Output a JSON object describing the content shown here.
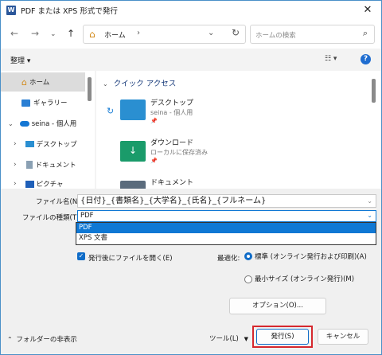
{
  "window": {
    "title": "PDF または XPS 形式で発行",
    "app_icon_letter": "W"
  },
  "nav": {
    "back_icon": "arrow-left-icon",
    "forward_icon": "arrow-right-icon",
    "up_icon": "arrow-up-icon",
    "address_parts": [
      "ホーム"
    ],
    "search_placeholder": "ホームの検索"
  },
  "toolbar": {
    "organize_label": "整理 ▾",
    "view_icon": "view-options-icon",
    "help_label": "?"
  },
  "sidebar": {
    "items": [
      {
        "label": "ホーム",
        "icon": "home-icon"
      },
      {
        "label": "ギャラリー",
        "icon": "gallery-icon"
      },
      {
        "label": "seina - 個人用",
        "icon": "cloud-icon"
      },
      {
        "label": "デスクトップ",
        "icon": "desktop-icon"
      },
      {
        "label": "ドキュメント",
        "icon": "document-icon"
      },
      {
        "label": "ピクチャ",
        "icon": "picture-icon"
      }
    ]
  },
  "content": {
    "section_title": "クイック アクセス",
    "items": [
      {
        "name": "デスクトップ",
        "sub": "seina - 個人用",
        "color": "#2a8fd1"
      },
      {
        "name": "ダウンロード",
        "sub": "ローカルに保存済み",
        "color": "#1a9b6a"
      },
      {
        "name": "ドキュメント",
        "sub": "",
        "color": "#5a6b7c"
      }
    ]
  },
  "form": {
    "filename_label": "ファイル名(N):",
    "filename_value": "{日付}_{書類名}_{大学名}_{氏名}_{フルネーム}",
    "filetype_label": "ファイルの種類(T):",
    "filetype_value": "PDF",
    "filetype_options": [
      "PDF",
      "XPS 文書"
    ],
    "open_after_label": "発行後にファイルを開く(E)",
    "optimize_label": "最適化:",
    "optimize_standard": "標準 (オンライン発行および印刷)(A)",
    "optimize_minimum": "最小サイズ (オンライン発行)(M)",
    "options_button": "オプション(O)..."
  },
  "footer": {
    "hide_folders": "フォルダーの非表示",
    "tools_label": "ツール(L)",
    "publish_button": "発行(S)",
    "cancel_button": "キャンセル"
  },
  "colors": {
    "accent": "#0f6cc8",
    "highlight_outline": "#d6282e"
  }
}
